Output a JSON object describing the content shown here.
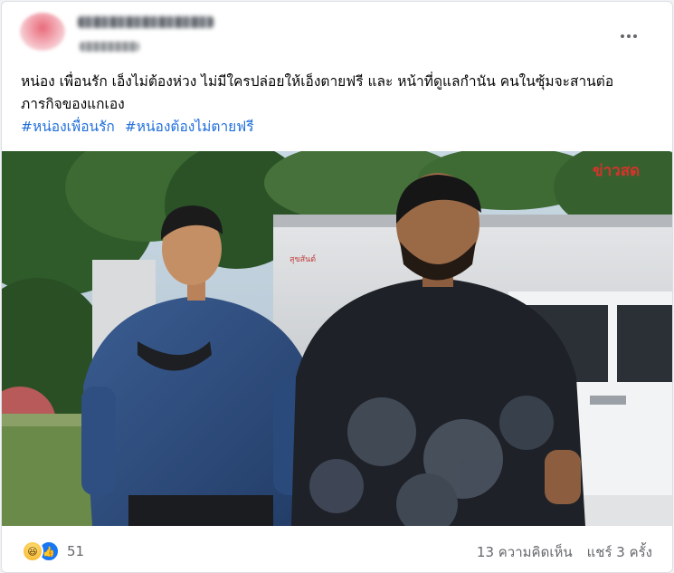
{
  "post": {
    "text": "หน่อง เพื่อนรัก เอ็งไม่ต้องห่วง ไม่มีใครปล่อยให้เอ็งตายฟรี และ หน้าที่ดูแลกำนัน คนในซุ้มจะสานต่อภารกิจของแกเอง",
    "hashtags": [
      "#หน่องเพื่อนรัก",
      "#หน่องต้องไม่ตายฟรี"
    ],
    "more_icon": "more-horizontal-icon"
  },
  "photo": {
    "watermark": "ข่าวสด",
    "truck_text": "สุขสันต์"
  },
  "footer": {
    "reaction_icons": [
      "haha-reaction-icon",
      "like-reaction-icon"
    ],
    "reaction_count": "51",
    "comments": "13 ความคิดเห็น",
    "shares": "แชร์ 3 ครั้ง"
  },
  "colors": {
    "link": "#216fdb",
    "secondary_text": "#65676b",
    "like_blue": "#1877f2"
  }
}
